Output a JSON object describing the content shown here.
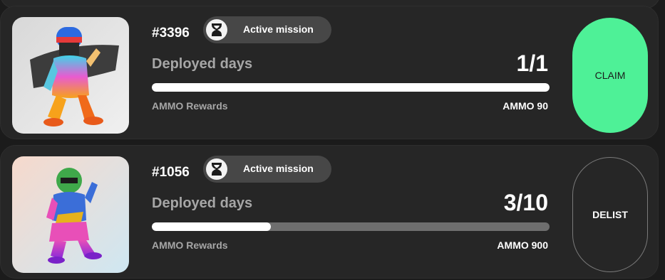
{
  "colors": {
    "accent_claim": "#4ef197",
    "card_bg": "#262626",
    "badge_bg": "#474747",
    "progress_fill": "#ffffff",
    "progress_track": "#6e6e6e"
  },
  "missions": [
    {
      "id": "#3396",
      "status": "Active mission",
      "status_icon": "hourglass-icon",
      "deployed_label": "Deployed days",
      "deployed_value": "1/1",
      "progress": 1.0,
      "rewards_label": "AMMO Rewards",
      "rewards_value": "AMMO 90",
      "action_label": "CLAIM"
    },
    {
      "id": "#1056",
      "status": "Active mission",
      "status_icon": "hourglass-icon",
      "deployed_label": "Deployed days",
      "deployed_value": "3/10",
      "progress": 0.3,
      "rewards_label": "AMMO Rewards",
      "rewards_value": "AMMO 900",
      "action_label": "DELIST"
    }
  ]
}
